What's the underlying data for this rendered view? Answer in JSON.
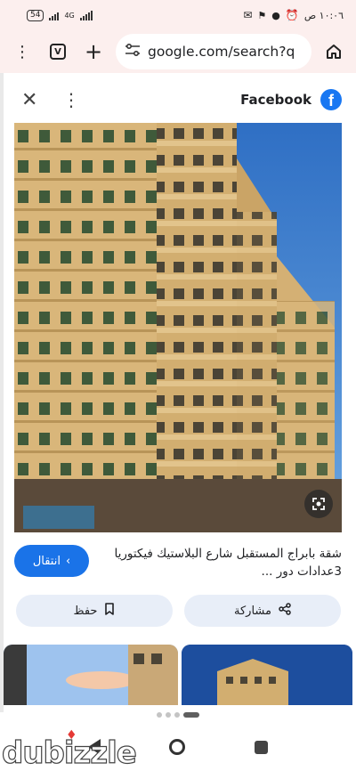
{
  "status_bar": {
    "battery": "54",
    "network": "4G",
    "time": "١٠:٠٦ ص"
  },
  "browser": {
    "url": "google.com/search?q",
    "tab_count": "V"
  },
  "result": {
    "site_name": "Facebook",
    "title": "شقة بابراج المستقبل شارع البلاستيك فيكتوريا 3عدادات دور ...",
    "visit_label": "انتقال",
    "save_label": "حفظ",
    "share_label": "مشاركة"
  },
  "watermark": "dubizzle",
  "colors": {
    "accent": "#1a73e8",
    "facebook": "#1877f2",
    "chip_bg": "#e8eef8",
    "chrome_bg": "#fcefee"
  },
  "icons": [
    "close-icon",
    "kebab-menu-icon",
    "facebook-logo",
    "google-lens-icon",
    "bookmark-icon",
    "share-icon",
    "chevron-left-icon",
    "home-icon",
    "plus-icon",
    "tune-icon"
  ]
}
